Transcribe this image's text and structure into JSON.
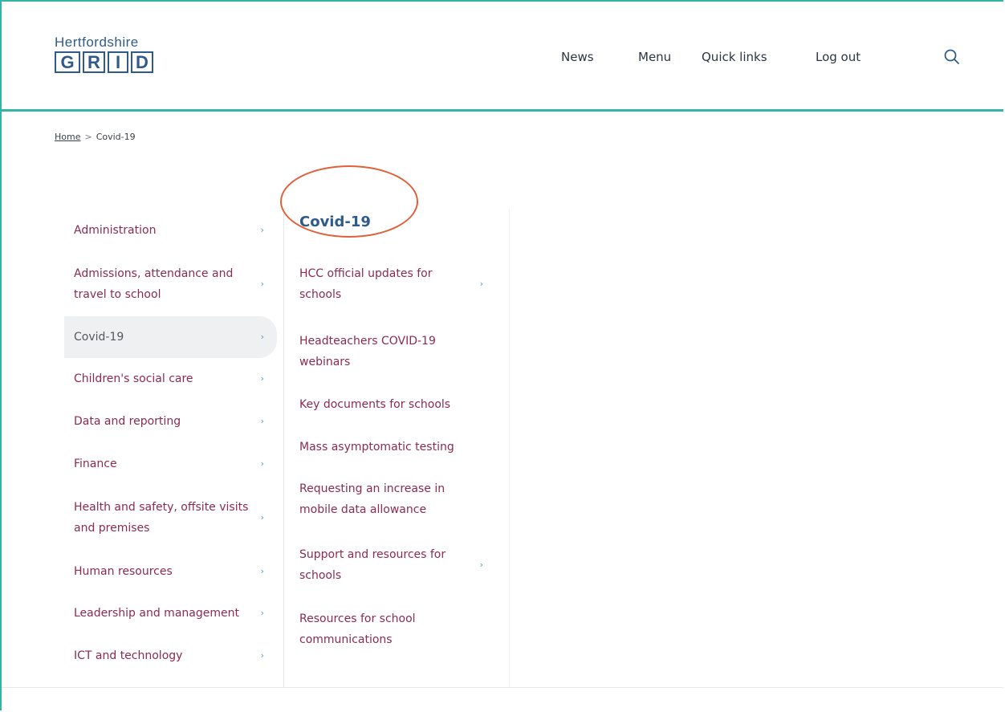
{
  "logo": {
    "top_text": "Hertfordshire",
    "letters": [
      "G",
      "R",
      "I",
      "D"
    ]
  },
  "nav": {
    "items": [
      "News",
      "Menu",
      "Quick links",
      "Log out"
    ],
    "search_icon": "search-icon"
  },
  "breadcrumb": {
    "home": "Home",
    "separator": ">",
    "current": "Covid-19"
  },
  "left_menu": {
    "items": [
      {
        "label": "Administration",
        "active": false
      },
      {
        "label": "Admissions, attendance and travel to school",
        "active": false
      },
      {
        "label": "Covid-19",
        "active": true
      },
      {
        "label": "Children's social care",
        "active": false
      },
      {
        "label": "Data and reporting",
        "active": false
      },
      {
        "label": "Finance",
        "active": false
      },
      {
        "label": "Health and safety, offsite visits and premises",
        "active": false
      },
      {
        "label": "Human resources",
        "active": false
      },
      {
        "label": "Leadership and management",
        "active": false
      },
      {
        "label": "ICT and technology",
        "active": false
      }
    ],
    "chevron": "›"
  },
  "sub_menu": {
    "title": "Covid-19",
    "items": [
      {
        "label": "HCC official updates for schools",
        "has_children": true
      },
      {
        "label": "Headteachers COVID-19 webinars",
        "has_children": false
      },
      {
        "label": "Key documents for schools",
        "has_children": false
      },
      {
        "label": "Mass asymptomatic testing",
        "has_children": false
      },
      {
        "label": "Requesting an increase in mobile data allowance",
        "has_children": false
      },
      {
        "label": "Support and resources for schools",
        "has_children": true
      },
      {
        "label": "Resources for school communications",
        "has_children": false
      }
    ]
  },
  "colors": {
    "accent_teal": "#33b5a5",
    "brand_blue": "#2f5b8b",
    "link_maroon": "#8c2a50",
    "chevron_teal": "#3aa9b8",
    "annotation_orange": "#e1603a"
  }
}
